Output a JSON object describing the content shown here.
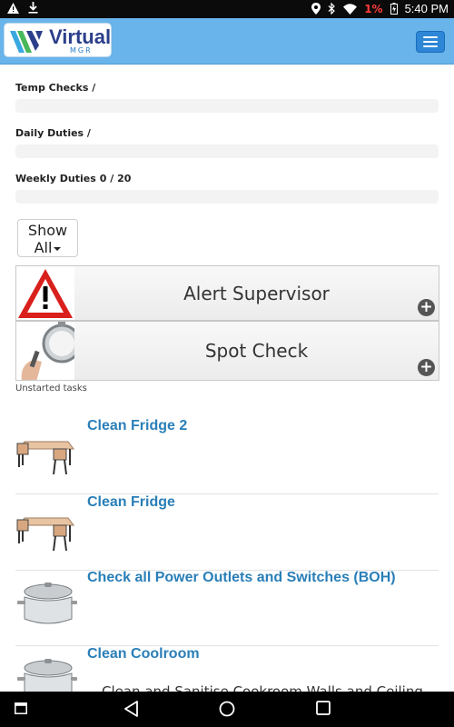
{
  "status_bar": {
    "battery_percent": "1%",
    "time": "5:40 PM"
  },
  "header": {
    "logo_text": "Virtual",
    "logo_subtext": "MGR"
  },
  "progress": [
    {
      "label": "Temp Checks /",
      "value": ""
    },
    {
      "label": "Daily Duties /",
      "value": ""
    },
    {
      "label": "Weekly Duties",
      "value": "0 / 20"
    }
  ],
  "filter": {
    "line1": "Show",
    "line2": "All"
  },
  "actions": [
    {
      "label": "Alert Supervisor",
      "icon": "alert-warning-icon"
    },
    {
      "label": "Spot Check",
      "icon": "stopwatch-icon"
    }
  ],
  "section_caption": "Unstarted tasks",
  "tasks": [
    {
      "title": "Clean Fridge 2",
      "icon": "table-chairs-icon"
    },
    {
      "title": "Clean Fridge",
      "icon": "table-chairs-icon"
    },
    {
      "title": "Check all Power Outlets and Switches (BOH)",
      "icon": "cooking-pot-icon"
    },
    {
      "title": "Clean Coolroom",
      "icon": "cooking-pot-icon"
    }
  ],
  "partial_task_text": "Clean and Sanitise Cookroom Walls and Ceiling",
  "colors": {
    "header": "#69b4ea",
    "task_title": "#2a7fb8",
    "battery_low": "#ff3b3b"
  }
}
